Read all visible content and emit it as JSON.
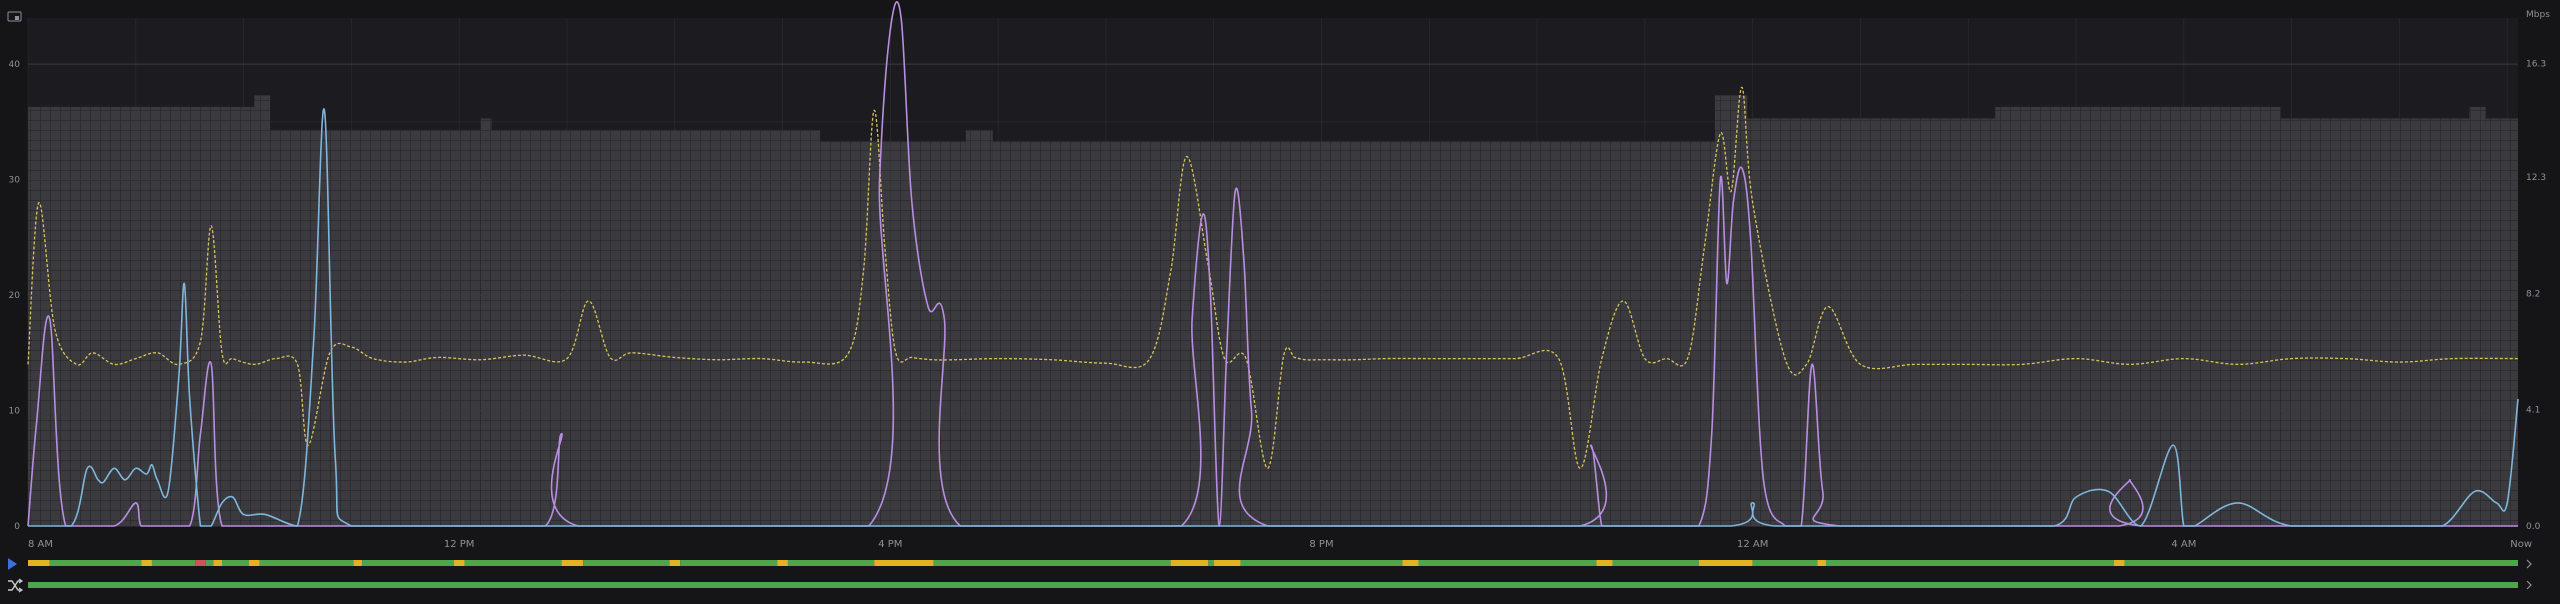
{
  "colors": {
    "background": "#151518",
    "plot_background": "#2b2b2f",
    "grid": "#3a3a40",
    "bar_fill": "#3a3a3f",
    "bar_grid": "#222226",
    "series_yellow": "#d8c45a",
    "series_purple": "#b98ee0",
    "series_blue": "#7fb6dc",
    "status_green": "#4ea54e",
    "status_yellow": "#e2b222",
    "status_red": "#d6505a",
    "play_blue": "#3d71d9"
  },
  "icons": {
    "top_left": "display-icon",
    "play": "play-icon",
    "shuffle": "shuffle-icon",
    "row_end": "chevron-right-icon"
  },
  "chart_data": {
    "type": "line",
    "right_axis_unit": "Mbps",
    "y_left_ticks": [
      "0",
      "10",
      "20",
      "30",
      "40"
    ],
    "y_left_range": [
      0,
      44
    ],
    "y_right_ticks": [
      "0.0",
      "4.1",
      "8.2",
      "12.3",
      "16.3"
    ],
    "y_right_range": [
      0,
      17.9
    ],
    "x_ticks": [
      "8 AM",
      "12 PM",
      "4 PM",
      "8 PM",
      "12 AM",
      "4 AM",
      "Now"
    ],
    "x_tick_hours": [
      0,
      4,
      8,
      12,
      16,
      20,
      23.1
    ],
    "x_range_hours": [
      0,
      23.1
    ],
    "grid": true,
    "bars": {
      "name": "",
      "segments": [
        {
          "from": 0.0,
          "to": 2.1,
          "value": 36.3
        },
        {
          "from": 2.1,
          "to": 2.25,
          "value": 37.3
        },
        {
          "from": 2.25,
          "to": 4.2,
          "value": 34.3
        },
        {
          "from": 4.2,
          "to": 4.3,
          "value": 35.3
        },
        {
          "from": 4.3,
          "to": 7.35,
          "value": 34.3
        },
        {
          "from": 7.35,
          "to": 8.7,
          "value": 33.3
        },
        {
          "from": 8.7,
          "to": 8.95,
          "value": 34.3
        },
        {
          "from": 8.95,
          "to": 15.65,
          "value": 33.3
        },
        {
          "from": 15.65,
          "to": 15.95,
          "value": 37.3
        },
        {
          "from": 15.95,
          "to": 18.25,
          "value": 35.3
        },
        {
          "from": 18.25,
          "to": 20.9,
          "value": 36.3
        },
        {
          "from": 20.9,
          "to": 22.65,
          "value": 35.3
        },
        {
          "from": 22.65,
          "to": 22.8,
          "value": 36.3
        },
        {
          "from": 22.8,
          "to": 23.1,
          "value": 35.3
        }
      ]
    },
    "series": [
      {
        "color": "#d8c45a",
        "dashed": true,
        "x": [
          0,
          0.1,
          0.25,
          0.45,
          0.6,
          0.8,
          1.0,
          1.2,
          1.4,
          1.6,
          1.7,
          1.8,
          1.9,
          2.1,
          2.3,
          2.5,
          2.6,
          2.8,
          3.0,
          3.2,
          3.5,
          3.8,
          4.2,
          4.6,
          5.0,
          5.2,
          5.4,
          5.6,
          6.0,
          6.4,
          6.8,
          7.2,
          7.6,
          7.75,
          7.85,
          7.95,
          8.05,
          8.2,
          8.4,
          8.6,
          9.0,
          9.5,
          10.0,
          10.4,
          10.6,
          10.75,
          10.95,
          11.1,
          11.3,
          11.5,
          11.65,
          11.75,
          11.85,
          12.0,
          12.3,
          12.6,
          13.0,
          13.4,
          13.8,
          14.2,
          14.4,
          14.6,
          14.8,
          15.0,
          15.2,
          15.4,
          15.55,
          15.7,
          15.8,
          15.9,
          16.0,
          16.3,
          16.5,
          16.7,
          17.0,
          17.5,
          18.0,
          18.5,
          19.0,
          19.5,
          20.0,
          20.5,
          21.0,
          21.5,
          22.0,
          22.5,
          23.1
        ],
        "y": [
          14,
          28,
          17,
          14,
          15,
          14,
          14.5,
          15,
          14,
          16,
          26,
          15,
          14.5,
          14,
          14.5,
          14,
          7,
          15,
          15.5,
          14.5,
          14.2,
          14.6,
          14.4,
          14.8,
          14.5,
          19.5,
          14.6,
          15,
          14.6,
          14.4,
          14.5,
          14.2,
          14.8,
          22,
          36,
          24,
          15,
          14.6,
          14.4,
          14.4,
          14.5,
          14.4,
          14.1,
          14.4,
          22,
          32,
          22.5,
          14.5,
          14.5,
          5,
          14.8,
          14.6,
          14.4,
          14.4,
          14.4,
          14.5,
          14.5,
          14.5,
          14.5,
          14.5,
          5,
          14.5,
          19.5,
          14.5,
          14.5,
          14.6,
          24,
          34,
          29,
          38,
          28,
          14.5,
          14,
          19,
          14,
          14,
          14,
          14,
          14.5,
          14,
          14.5,
          14,
          14.5,
          14.5,
          14.2,
          14.5,
          14.5
        ]
      },
      {
        "color": "#b98ee0",
        "dashed": false,
        "x": [
          0,
          0.08,
          0.2,
          0.35,
          0.8,
          1.0,
          1.05,
          1.2,
          1.5,
          1.6,
          1.7,
          1.8,
          2.2,
          4.0,
          4.8,
          4.95,
          5.1,
          7.8,
          7.9,
          8.0,
          8.1,
          8.2,
          8.35,
          8.5,
          8.65,
          10.7,
          10.8,
          10.9,
          10.97,
          11.05,
          11.12,
          11.2,
          11.28,
          11.35,
          11.5,
          14.4,
          14.5,
          14.6,
          14.7,
          15.2,
          15.5,
          15.62,
          15.7,
          15.76,
          15.82,
          15.9,
          15.98,
          16.1,
          16.3,
          16.45,
          16.55,
          16.65,
          16.8,
          19.4,
          19.5,
          19.6,
          23.1
        ],
        "y": [
          0,
          9,
          18,
          0,
          0,
          2,
          0,
          0,
          0,
          8,
          14,
          0,
          0,
          0,
          0,
          8,
          0,
          0,
          30,
          43,
          44,
          28,
          19,
          18,
          0,
          0,
          18,
          27,
          20,
          0,
          15,
          29,
          23,
          10,
          0,
          0,
          7,
          0,
          0,
          0,
          0,
          8,
          30,
          21,
          28,
          31,
          25,
          4,
          0,
          0,
          14,
          3,
          0,
          0,
          4,
          0,
          0
        ]
      },
      {
        "color": "#7fb6dc",
        "dashed": false,
        "x": [
          0,
          0.4,
          0.55,
          0.65,
          0.7,
          0.8,
          0.9,
          1.0,
          1.1,
          1.15,
          1.2,
          1.3,
          1.4,
          1.45,
          1.5,
          1.6,
          1.65,
          1.7,
          1.8,
          1.9,
          2.0,
          2.2,
          2.5,
          2.65,
          2.75,
          2.85,
          3.0,
          4.0,
          6.0,
          8.0,
          10.0,
          12.0,
          14.0,
          15.8,
          16.0,
          16.2,
          18.0,
          18.8,
          19.0,
          19.3,
          19.6,
          19.9,
          20.0,
          20.1,
          20.5,
          21.0,
          22.0,
          22.4,
          22.7,
          22.9,
          23.0,
          23.1
        ],
        "y": [
          0,
          0,
          5,
          4,
          3.8,
          5,
          4,
          5,
          4.5,
          5.3,
          4,
          3,
          13,
          21,
          11,
          0,
          0,
          0,
          2,
          2.5,
          1,
          1,
          0,
          16,
          36,
          6,
          0,
          0,
          0,
          0,
          0,
          0,
          0,
          0,
          2,
          0,
          0,
          0,
          2.5,
          3,
          0,
          7,
          0,
          0,
          2,
          0,
          0,
          0,
          3,
          2,
          2,
          11
        ]
      }
    ],
    "status_rows": [
      {
        "icon": "play-icon",
        "segments": [
          {
            "from": 0.0,
            "to": 0.2,
            "state": "yellow"
          },
          {
            "from": 0.2,
            "to": 1.05,
            "state": "green"
          },
          {
            "from": 1.05,
            "to": 1.15,
            "state": "yellow"
          },
          {
            "from": 1.15,
            "to": 1.55,
            "state": "green"
          },
          {
            "from": 1.55,
            "to": 1.65,
            "state": "red"
          },
          {
            "from": 1.65,
            "to": 1.72,
            "state": "green"
          },
          {
            "from": 1.72,
            "to": 1.8,
            "state": "yellow"
          },
          {
            "from": 1.8,
            "to": 2.05,
            "state": "green"
          },
          {
            "from": 2.05,
            "to": 2.15,
            "state": "yellow"
          },
          {
            "from": 2.15,
            "to": 3.02,
            "state": "green"
          },
          {
            "from": 3.02,
            "to": 3.1,
            "state": "yellow"
          },
          {
            "from": 3.1,
            "to": 3.95,
            "state": "green"
          },
          {
            "from": 3.95,
            "to": 4.05,
            "state": "yellow"
          },
          {
            "from": 4.05,
            "to": 4.95,
            "state": "green"
          },
          {
            "from": 4.95,
            "to": 5.15,
            "state": "yellow"
          },
          {
            "from": 5.15,
            "to": 5.95,
            "state": "green"
          },
          {
            "from": 5.95,
            "to": 6.05,
            "state": "yellow"
          },
          {
            "from": 6.05,
            "to": 6.95,
            "state": "green"
          },
          {
            "from": 6.95,
            "to": 7.05,
            "state": "yellow"
          },
          {
            "from": 7.05,
            "to": 7.85,
            "state": "green"
          },
          {
            "from": 7.85,
            "to": 8.4,
            "state": "yellow"
          },
          {
            "from": 8.4,
            "to": 10.6,
            "state": "green"
          },
          {
            "from": 10.6,
            "to": 10.95,
            "state": "yellow"
          },
          {
            "from": 10.95,
            "to": 11.0,
            "state": "green"
          },
          {
            "from": 11.0,
            "to": 11.25,
            "state": "yellow"
          },
          {
            "from": 11.25,
            "to": 12.75,
            "state": "green"
          },
          {
            "from": 12.75,
            "to": 12.9,
            "state": "yellow"
          },
          {
            "from": 12.9,
            "to": 14.55,
            "state": "green"
          },
          {
            "from": 14.55,
            "to": 14.7,
            "state": "yellow"
          },
          {
            "from": 14.7,
            "to": 15.5,
            "state": "green"
          },
          {
            "from": 15.5,
            "to": 16.0,
            "state": "yellow"
          },
          {
            "from": 16.0,
            "to": 16.6,
            "state": "green"
          },
          {
            "from": 16.6,
            "to": 16.68,
            "state": "yellow"
          },
          {
            "from": 16.68,
            "to": 19.35,
            "state": "green"
          },
          {
            "from": 19.35,
            "to": 19.45,
            "state": "yellow"
          },
          {
            "from": 19.45,
            "to": 23.1,
            "state": "green"
          }
        ]
      },
      {
        "icon": "shuffle-icon",
        "segments": [
          {
            "from": 0.0,
            "to": 23.1,
            "state": "green"
          }
        ]
      }
    ]
  }
}
